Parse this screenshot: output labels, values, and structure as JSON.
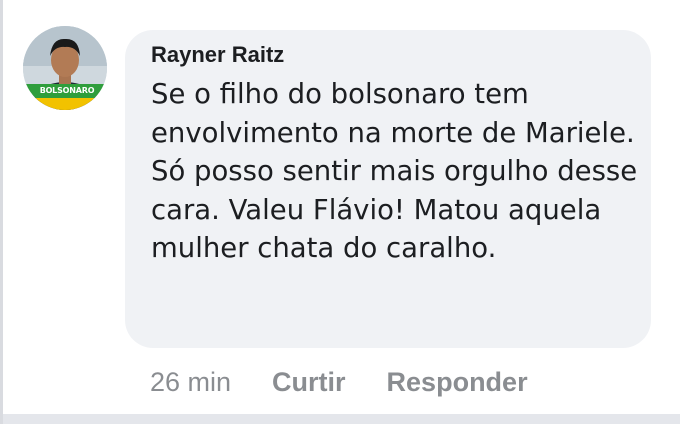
{
  "comment": {
    "author": "Rayner Raitz",
    "avatar_icon": "user-avatar-photo",
    "avatar_tag": "BOLSONARO",
    "text": "Se o filho do bolsonaro tem envolvimento na morte de Mariele. Só posso sentir mais orgulho desse cara. Valeu Flávio! Matou aquela mulher chata do caralho.",
    "time": "26 min",
    "like_label": "Curtir",
    "reply_label": "Responder"
  },
  "colors": {
    "bubble_bg": "#f0f2f5",
    "text": "#1c1e21",
    "meta": "#8a8d91",
    "avatar_tag_bg": "#2f9e3c"
  }
}
